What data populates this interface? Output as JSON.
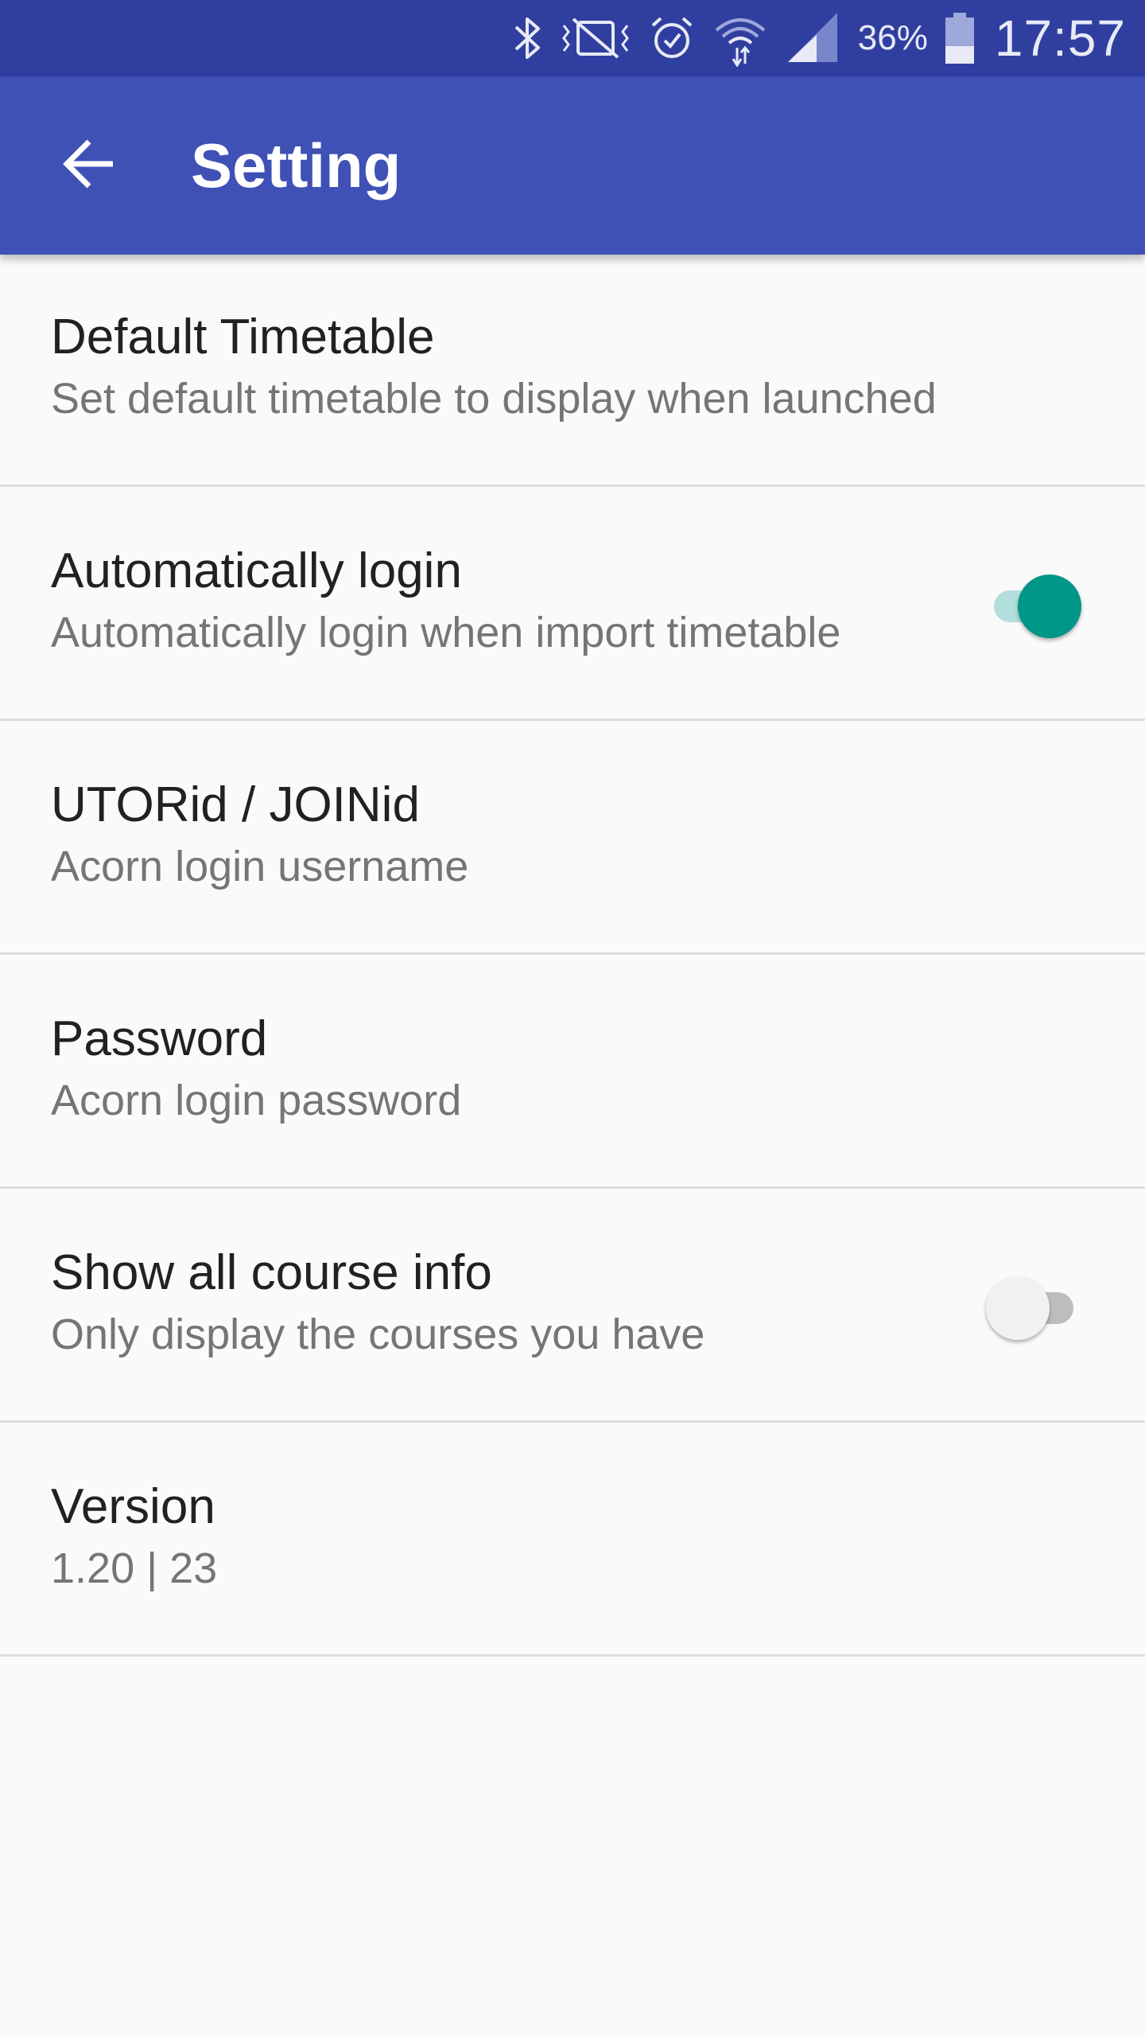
{
  "status_bar": {
    "icons": [
      "bluetooth-icon",
      "vibrate-off-icon",
      "alarm-icon",
      "wifi-icon",
      "cellular-signal-icon",
      "battery-icon"
    ],
    "battery_percent": "36%",
    "time": "17:57"
  },
  "app_bar": {
    "back_icon": "arrow-back-icon",
    "title": "Setting"
  },
  "settings": {
    "items": [
      {
        "title": "Default Timetable",
        "summary": "Set default timetable to display when launched"
      },
      {
        "title": "Automatically login",
        "summary": "Automatically login when import timetable",
        "switch_on": true
      },
      {
        "title": "UTORid / JOINid",
        "summary": "Acorn login username"
      },
      {
        "title": "Password",
        "summary": "Acorn login password"
      },
      {
        "title": "Show all course info",
        "summary": "Only display the courses you have",
        "switch_on": false
      },
      {
        "title": "Version",
        "summary": "1.20 | 23"
      }
    ]
  },
  "colors": {
    "status_bar": "#303f9f",
    "app_bar": "#3f51b5",
    "accent": "#009688",
    "background": "#fafafa"
  }
}
